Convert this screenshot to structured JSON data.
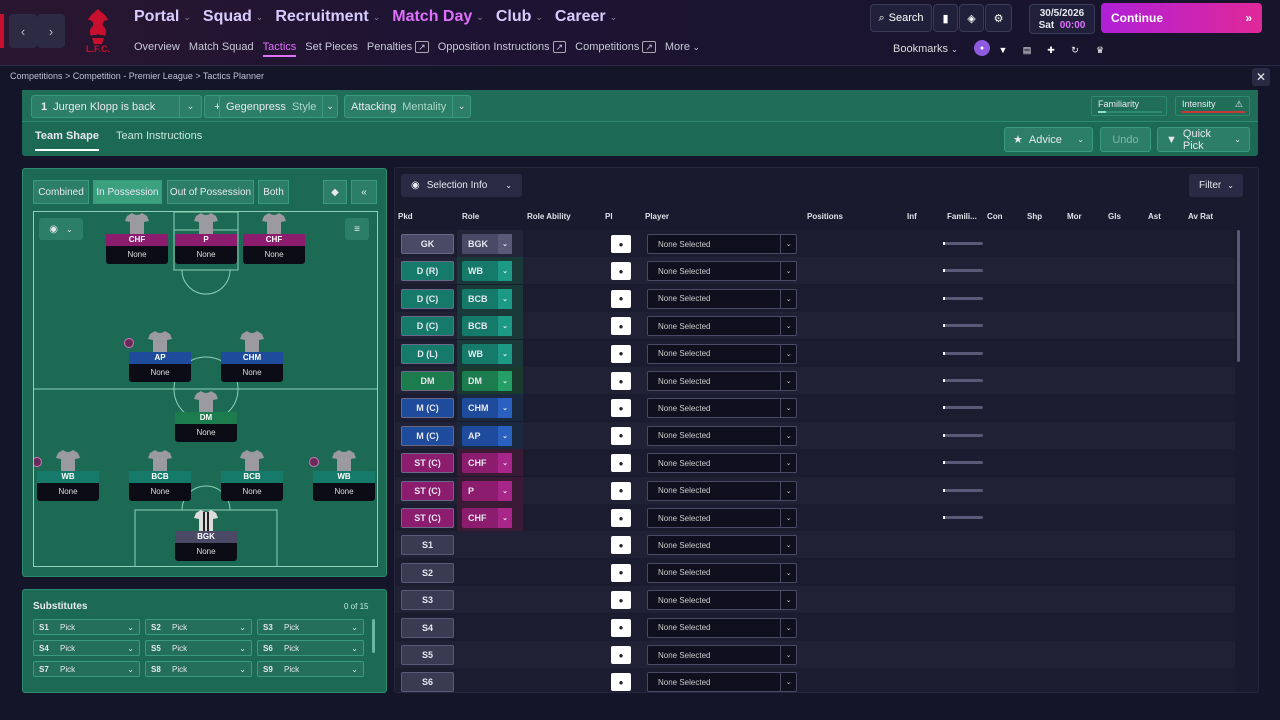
{
  "topnav": {
    "main": [
      {
        "label": "Portal",
        "active": false
      },
      {
        "label": "Squad",
        "active": false
      },
      {
        "label": "Recruitment",
        "active": false
      },
      {
        "label": "Match Day",
        "active": true
      },
      {
        "label": "Club",
        "active": false
      },
      {
        "label": "Career",
        "active": false
      }
    ],
    "sub": [
      {
        "label": "Overview",
        "ext": false,
        "active": false
      },
      {
        "label": "Match Squad",
        "ext": false,
        "active": false
      },
      {
        "label": "Tactics",
        "ext": false,
        "active": true
      },
      {
        "label": "Set Pieces",
        "ext": false,
        "active": false
      },
      {
        "label": "Penalties",
        "ext": true,
        "active": false
      },
      {
        "label": "Opposition Instructions",
        "ext": true,
        "active": false
      },
      {
        "label": "Competitions",
        "ext": true,
        "active": false
      },
      {
        "label": "More",
        "ext": false,
        "active": false
      }
    ],
    "search_label": "Search",
    "date": "30/5/2026",
    "day": "Sat",
    "time": "00:00",
    "continue_label": "Continue",
    "bookmarks_label": "Bookmarks",
    "crest_text": "L.F.C."
  },
  "breadcrumb": "Competitions  >  Competition - Premier League  >  Tactics Planner",
  "tactics": {
    "slot": "1",
    "name": "Jurgen Klopp is back",
    "style_value": "Gegenpress",
    "style_label": "Style",
    "mentality_value": "Attacking",
    "mentality_label": "Mentality",
    "familiarity_label": "Familiarity",
    "intensity_label": "Intensity",
    "tabs": [
      "Team Shape",
      "Team Instructions"
    ],
    "advice_label": "Advice",
    "undo_label": "Undo",
    "quickpick_label": "Quick Pick"
  },
  "pitchpanel": {
    "modes": [
      "Combined",
      "In Possession",
      "Out of Possession",
      "Both"
    ],
    "active_mode": "In Possession",
    "players": [
      {
        "role": "CHF",
        "name": "None",
        "color": "#8b1c6e"
      },
      {
        "role": "P",
        "name": "None",
        "color": "#8b1c6e"
      },
      {
        "role": "CHF",
        "name": "None",
        "color": "#8b1c6e"
      },
      {
        "role": "AP",
        "name": "None",
        "color": "#1e4b9b"
      },
      {
        "role": "CHM",
        "name": "None",
        "color": "#1e4b9b"
      },
      {
        "role": "DM",
        "name": "None",
        "color": "#1c7c4e"
      },
      {
        "role": "WB",
        "name": "None",
        "color": "#157a6a"
      },
      {
        "role": "BCB",
        "name": "None",
        "color": "#157a6a"
      },
      {
        "role": "BCB",
        "name": "None",
        "color": "#157a6a"
      },
      {
        "role": "WB",
        "name": "None",
        "color": "#157a6a"
      },
      {
        "role": "BGK",
        "name": "None",
        "color": "#4a4a66"
      }
    ]
  },
  "subs": {
    "title": "Substitutes",
    "count": "0 of 15",
    "slots": [
      {
        "id": "S1",
        "value": "Pick"
      },
      {
        "id": "S2",
        "value": "Pick"
      },
      {
        "id": "S3",
        "value": "Pick"
      },
      {
        "id": "S4",
        "value": "Pick"
      },
      {
        "id": "S5",
        "value": "Pick"
      },
      {
        "id": "S6",
        "value": "Pick"
      },
      {
        "id": "S7",
        "value": "Pick"
      },
      {
        "id": "S8",
        "value": "Pick"
      },
      {
        "id": "S9",
        "value": "Pick"
      }
    ]
  },
  "table": {
    "selection_info_label": "Selection Info",
    "filter_label": "Filter",
    "headers": [
      "Pkd",
      "Role",
      "Role Ability",
      "PI",
      "Player",
      "Positions",
      "Inf",
      "Famili...",
      "Con",
      "Shp",
      "Mor",
      "Gls",
      "Ast",
      "Av Rat"
    ],
    "rows": [
      {
        "pos": "GK",
        "role": "BGK",
        "player": "None Selected",
        "group": "gk"
      },
      {
        "pos": "D (R)",
        "role": "WB",
        "player": "None Selected",
        "group": "def"
      },
      {
        "pos": "D (C)",
        "role": "BCB",
        "player": "None Selected",
        "group": "def"
      },
      {
        "pos": "D (C)",
        "role": "BCB",
        "player": "None Selected",
        "group": "def"
      },
      {
        "pos": "D (L)",
        "role": "WB",
        "player": "None Selected",
        "group": "def"
      },
      {
        "pos": "DM",
        "role": "DM",
        "player": "None Selected",
        "group": "dm"
      },
      {
        "pos": "M (C)",
        "role": "CHM",
        "player": "None Selected",
        "group": "mid"
      },
      {
        "pos": "M (C)",
        "role": "AP",
        "player": "None Selected",
        "group": "mid"
      },
      {
        "pos": "ST (C)",
        "role": "CHF",
        "player": "None Selected",
        "group": "att"
      },
      {
        "pos": "ST (C)",
        "role": "P",
        "player": "None Selected",
        "group": "att"
      },
      {
        "pos": "ST (C)",
        "role": "CHF",
        "player": "None Selected",
        "group": "att"
      },
      {
        "pos": "S1",
        "role": "",
        "player": "None Selected",
        "group": "sub"
      },
      {
        "pos": "S2",
        "role": "",
        "player": "None Selected",
        "group": "sub"
      },
      {
        "pos": "S3",
        "role": "",
        "player": "None Selected",
        "group": "sub"
      },
      {
        "pos": "S4",
        "role": "",
        "player": "None Selected",
        "group": "sub"
      },
      {
        "pos": "S5",
        "role": "",
        "player": "None Selected",
        "group": "sub"
      },
      {
        "pos": "S6",
        "role": "",
        "player": "None Selected",
        "group": "sub"
      }
    ]
  },
  "colors": {
    "accent": "#e270ff",
    "tactic_green": "#1c6a54",
    "gk": "#4a4a66",
    "def": "#157a6a",
    "dm": "#1c7c4e",
    "mid": "#1e4b9b",
    "att": "#8b1c6e"
  }
}
